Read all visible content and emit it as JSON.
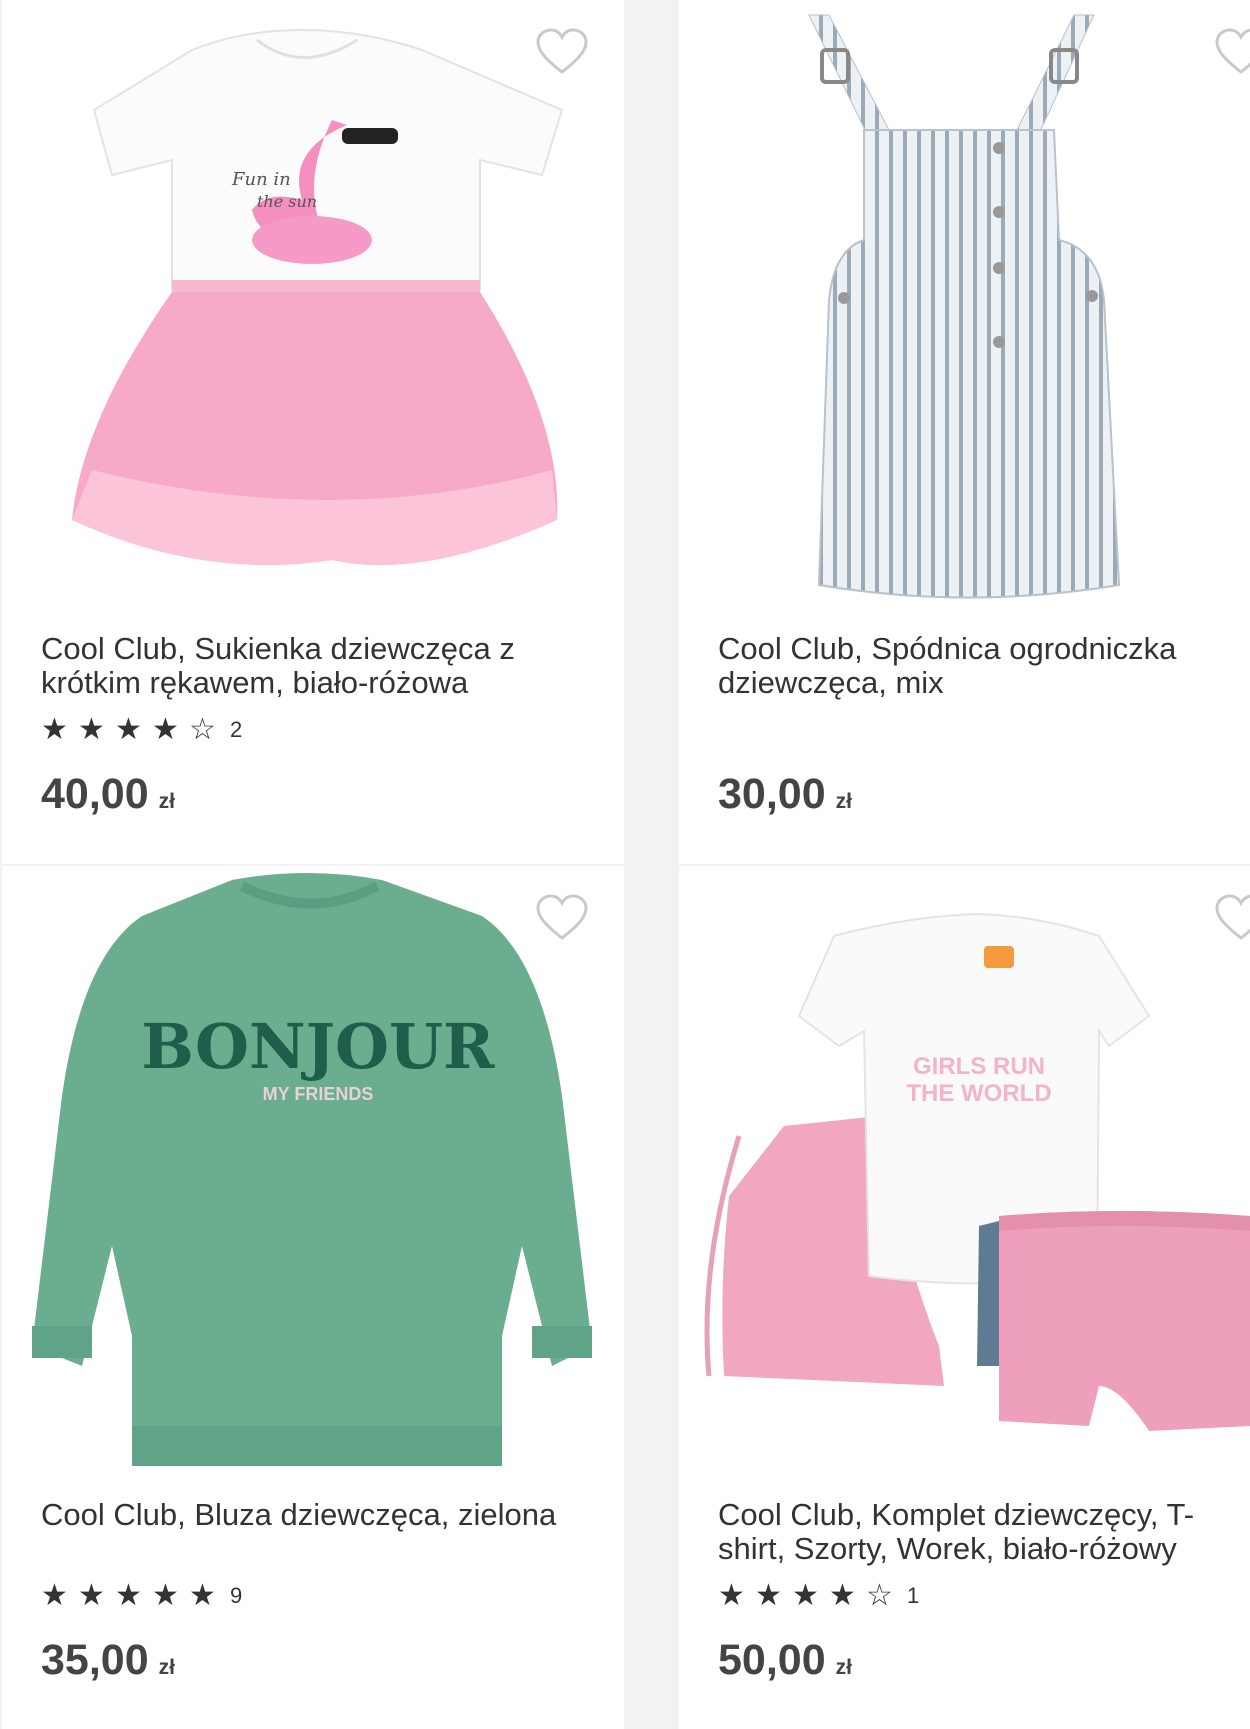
{
  "products": [
    {
      "title": "Cool Club, Sukienka dziewczęca z krótkim rękawem, biało-różowa",
      "rating_stars": 4,
      "rating_count": "2",
      "price": "40,00",
      "currency": "zł",
      "image_text": [
        "Fun in",
        "the sun"
      ],
      "icon": "flamingo-dress-image"
    },
    {
      "title": "Cool Club, Spódnica ogrodniczka dziewczęca, mix",
      "rating_stars": null,
      "rating_count": "",
      "price": "30,00",
      "currency": "zł",
      "image_text": [],
      "icon": "striped-overall-dress-image"
    },
    {
      "title": "Cool Club, Bluza dziewczęca, zielona",
      "rating_stars": 5,
      "rating_count": "9",
      "price": "35,00",
      "currency": "zł",
      "image_text": [
        "BONJOUR",
        "MY FRIENDS"
      ],
      "icon": "green-sweatshirt-image"
    },
    {
      "title": "Cool Club, Komplet dziewczęcy, T-shirt, Szorty, Worek, biało-różowy",
      "rating_stars": 4,
      "rating_count": "1",
      "price": "50,00",
      "currency": "zł",
      "image_text": [
        "GIRLS RUN",
        "THE WORLD"
      ],
      "icon": "tshirt-shorts-bag-set-image"
    }
  ],
  "colors": {
    "star": "#333333",
    "heart_outline": "#c9c9c9",
    "price": "#444444",
    "background": "#f2f2f2"
  }
}
